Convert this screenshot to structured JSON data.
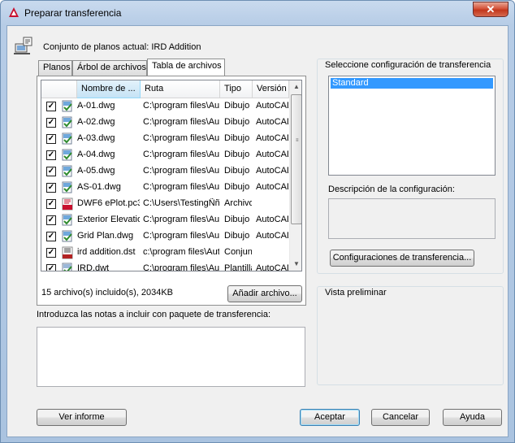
{
  "window": {
    "title": "Preparar transferencia",
    "close_label": "✕"
  },
  "header": {
    "current_set_label": "Conjunto de planos actual: IRD Addition"
  },
  "tabs": [
    {
      "label": "Planos",
      "active": false
    },
    {
      "label": "Árbol de archivos",
      "active": false
    },
    {
      "label": "Tabla de archivos",
      "active": true
    }
  ],
  "file_table": {
    "columns": [
      "Nombre de ...",
      "Ruta",
      "Tipo",
      "Versión"
    ],
    "rows": [
      {
        "name": "A-01.dwg",
        "path": "C:\\program files\\Aut",
        "type": "Dibujo c",
        "version": "AutoCAD",
        "checked": true,
        "icon": "dwg-file-icon"
      },
      {
        "name": "A-02.dwg",
        "path": "C:\\program files\\Aut",
        "type": "Dibujo c",
        "version": "AutoCAD",
        "checked": true,
        "icon": "dwg-file-icon"
      },
      {
        "name": "A-03.dwg",
        "path": "C:\\program files\\Aut",
        "type": "Dibujo c",
        "version": "AutoCAD",
        "checked": true,
        "icon": "dwg-file-icon"
      },
      {
        "name": "A-04.dwg",
        "path": "C:\\program files\\Aut",
        "type": "Dibujo c",
        "version": "AutoCAD",
        "checked": true,
        "icon": "dwg-file-icon"
      },
      {
        "name": "A-05.dwg",
        "path": "C:\\program files\\Aut",
        "type": "Dibujo c",
        "version": "AutoCAD",
        "checked": true,
        "icon": "dwg-file-icon"
      },
      {
        "name": "AS-01.dwg",
        "path": "C:\\program files\\Aut",
        "type": "Dibujo c",
        "version": "AutoCAD",
        "checked": true,
        "icon": "dwg-file-icon"
      },
      {
        "name": "DWF6 ePlot.pc3",
        "path": "C:\\Users\\TestingÑñ",
        "type": "Archivo",
        "version": "",
        "checked": true,
        "icon": "pc3-file-icon"
      },
      {
        "name": "Exterior Elevatio",
        "path": "C:\\program files\\Aut",
        "type": "Dibujo c",
        "version": "AutoCAD",
        "checked": true,
        "icon": "dwg-file-icon"
      },
      {
        "name": "Grid Plan.dwg",
        "path": "C:\\program files\\Aut",
        "type": "Dibujo c",
        "version": "AutoCAD",
        "checked": true,
        "icon": "dwg-file-icon"
      },
      {
        "name": "ird addition.dst",
        "path": "c:\\program files\\Auto",
        "type": "Conjunt",
        "version": "",
        "checked": true,
        "icon": "dst-file-icon"
      },
      {
        "name": "IRD.dwt",
        "path": "C:\\program files\\Aut",
        "type": "Plantilla",
        "version": "AutoCAD",
        "checked": true,
        "icon": "dwt-file-icon"
      }
    ]
  },
  "summary": {
    "count_label": "15 archivo(s) incluido(s), 2034KB",
    "add_file_button": "Añadir archivo..."
  },
  "notes": {
    "label": "Introduzca las notas a incluir con paquete de transferencia:",
    "value": ""
  },
  "right": {
    "config_label": "Seleccione configuración de transferencia",
    "configs": [
      "Standard"
    ],
    "selected_config": "Standard",
    "description_label": "Descripción de la configuración:",
    "description_value": "",
    "configs_button": "Configuraciones de transferencia...",
    "preview_label": "Vista preliminar"
  },
  "footer": {
    "report_button": "Ver informe",
    "accept_button": "Aceptar",
    "cancel_button": "Cancelar",
    "help_button": "Ayuda"
  },
  "colors": {
    "accent": "#3399ff",
    "title_close": "#c2371c",
    "autocad_red": "#c8102e"
  }
}
